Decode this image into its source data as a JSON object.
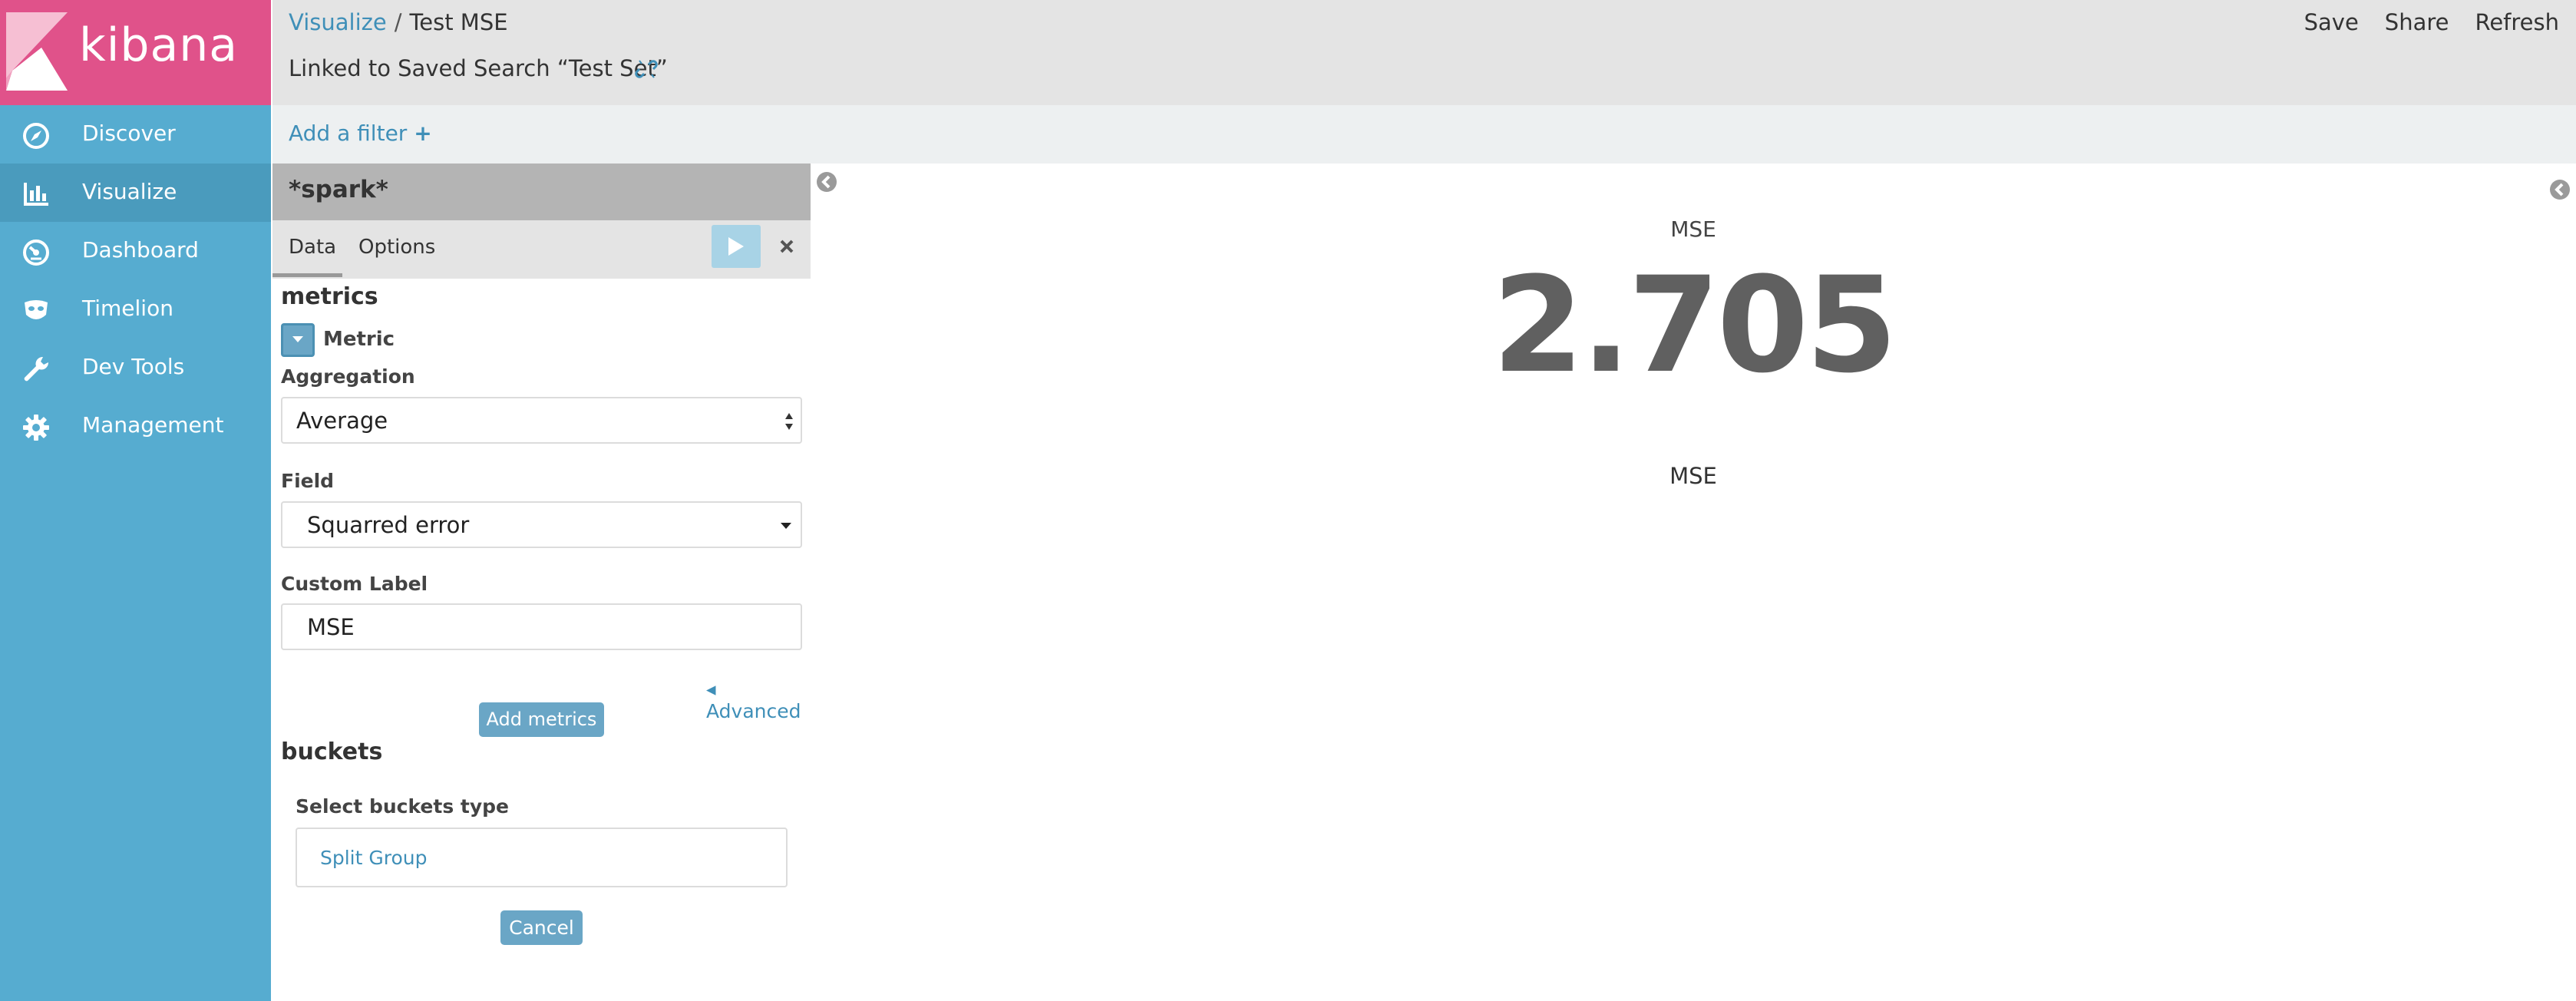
{
  "app": {
    "logo_text": "kibana"
  },
  "sidebar": {
    "items": [
      {
        "label": "Discover",
        "icon": "compass-icon",
        "active": false
      },
      {
        "label": "Visualize",
        "icon": "bar-chart-icon",
        "active": true
      },
      {
        "label": "Dashboard",
        "icon": "dashboard-gauge-icon",
        "active": false
      },
      {
        "label": "Timelion",
        "icon": "timelion-mask-icon",
        "active": false
      },
      {
        "label": "Dev Tools",
        "icon": "wrench-icon",
        "active": false
      },
      {
        "label": "Management",
        "icon": "gear-icon",
        "active": false
      }
    ]
  },
  "header": {
    "breadcrumb": {
      "root": "Visualize",
      "separator": "/",
      "current": "Test MSE"
    },
    "linked_search": "Linked to Saved Search “Test Set”",
    "actions": {
      "save": "Save",
      "share": "Share",
      "refresh": "Refresh"
    }
  },
  "filter_bar": {
    "add_filter": "Add a filter",
    "plus": "+"
  },
  "editor": {
    "index_pattern": "*spark*",
    "tabs": {
      "data": "Data",
      "options": "Options"
    },
    "metrics": {
      "section_title": "metrics",
      "metric_title": "Metric",
      "aggregation_label": "Aggregation",
      "aggregation_value": "Average",
      "field_label": "Field",
      "field_value": "Squarred error",
      "custom_label_label": "Custom Label",
      "custom_label_value": "MSE",
      "advanced_link": "Advanced",
      "add_metrics_button": "Add metrics"
    },
    "buckets": {
      "section_title": "buckets",
      "select_type_label": "Select buckets type",
      "option_split_group": "Split Group",
      "cancel_button": "Cancel"
    }
  },
  "visualization": {
    "top_label": "MSE",
    "value": "2.705",
    "bottom_label": "MSE"
  },
  "colors": {
    "sidebar_bg": "#56acd0",
    "logo_bg": "#e0528a",
    "link": "#3f8fb8",
    "button_bg": "#6aa6c6",
    "metric_value": "#606060"
  }
}
